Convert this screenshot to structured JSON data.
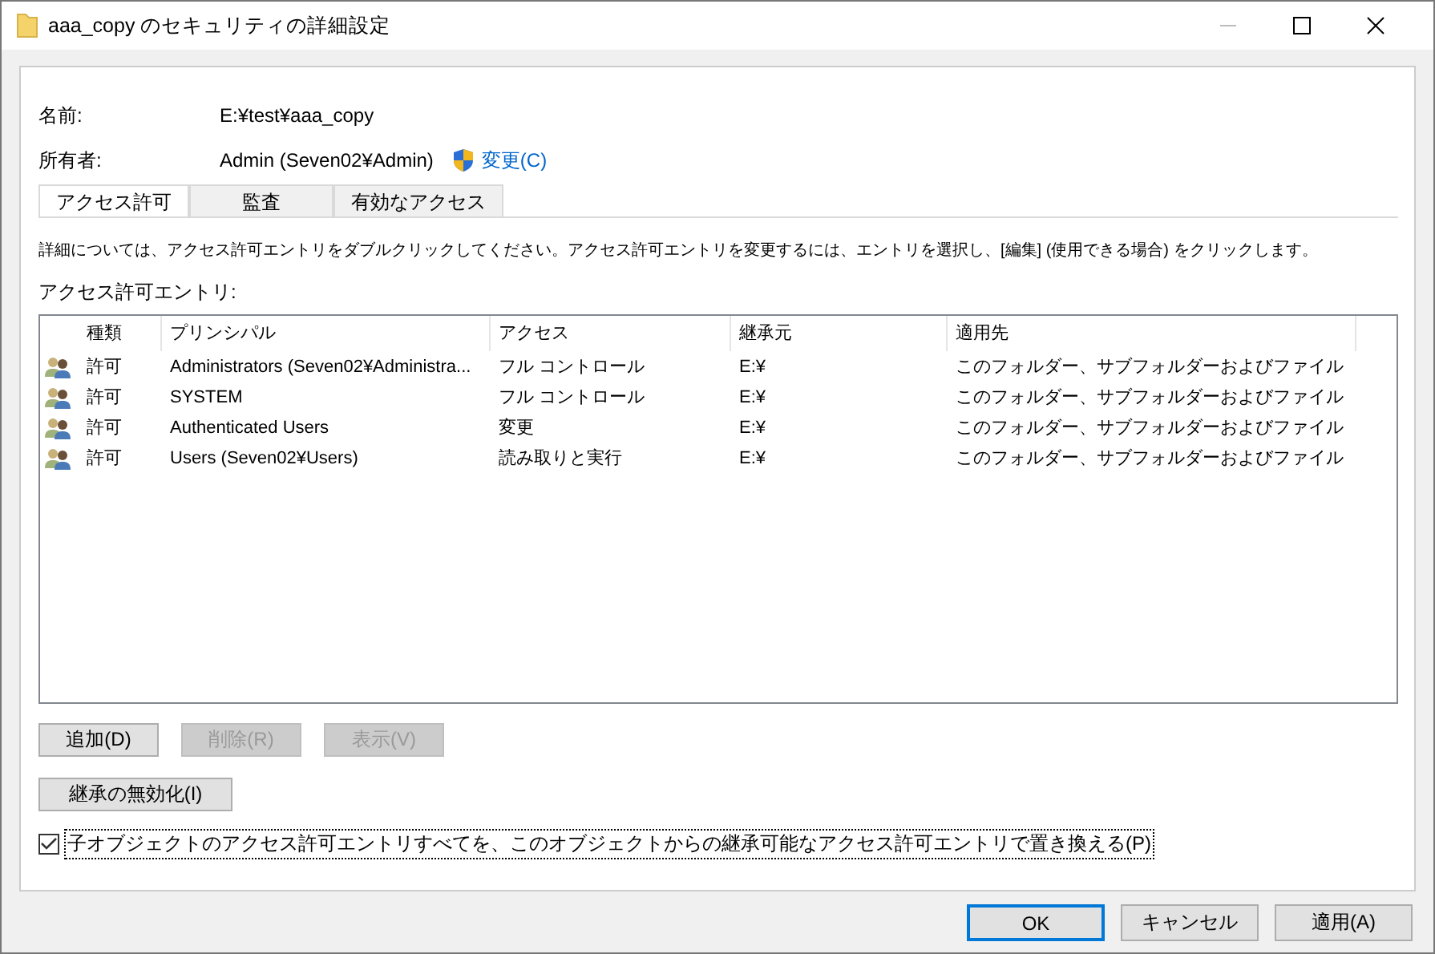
{
  "window": {
    "title": "aaa_copy のセキュリティの詳細設定"
  },
  "info": [
    {
      "label": "名前:",
      "value": "E:¥test¥aaa_copy"
    },
    {
      "label": "所有者:",
      "value": "Admin (Seven02¥Admin)",
      "link": "変更(C)"
    }
  ],
  "tabs": [
    {
      "label": "アクセス許可",
      "selected": true
    },
    {
      "label": "監査",
      "selected": false
    },
    {
      "label": "有効なアクセス",
      "selected": false
    }
  ],
  "description": "詳細については、アクセス許可エントリをダブルクリックしてください。アクセス許可エントリを変更するには、エントリを選択し、[編集] (使用できる場合) をクリックします。",
  "list_label": "アクセス許可エントリ:",
  "table": {
    "columns": [
      "種類",
      "プリンシパル",
      "アクセス",
      "継承元",
      "適用先"
    ],
    "rows": [
      [
        "許可",
        "Administrators (Seven02¥Administra...",
        "フル コントロール",
        "E:¥",
        "このフォルダー、サブフォルダーおよびファイル"
      ],
      [
        "許可",
        "SYSTEM",
        "フル コントロール",
        "E:¥",
        "このフォルダー、サブフォルダーおよびファイル"
      ],
      [
        "許可",
        "Authenticated Users",
        "変更",
        "E:¥",
        "このフォルダー、サブフォルダーおよびファイル"
      ],
      [
        "許可",
        "Users (Seven02¥Users)",
        "読み取りと実行",
        "E:¥",
        "このフォルダー、サブフォルダーおよびファイル"
      ]
    ]
  },
  "entry_buttons": [
    {
      "label": "追加(D)",
      "disabled": false
    },
    {
      "label": "削除(R)",
      "disabled": true
    },
    {
      "label": "表示(V)",
      "disabled": true
    }
  ],
  "inherit_button": {
    "label": "継承の無効化(I)"
  },
  "replace_checkbox": {
    "label": "子オブジェクトのアクセス許可エントリすべてを、このオブジェクトからの継承可能なアクセス許可エントリで置き換える(P)",
    "checked": true
  },
  "dialog_buttons": [
    {
      "label": "OK",
      "default": true
    },
    {
      "label": "キャンセル",
      "default": false
    },
    {
      "label": "適用(A)",
      "default": false
    }
  ]
}
